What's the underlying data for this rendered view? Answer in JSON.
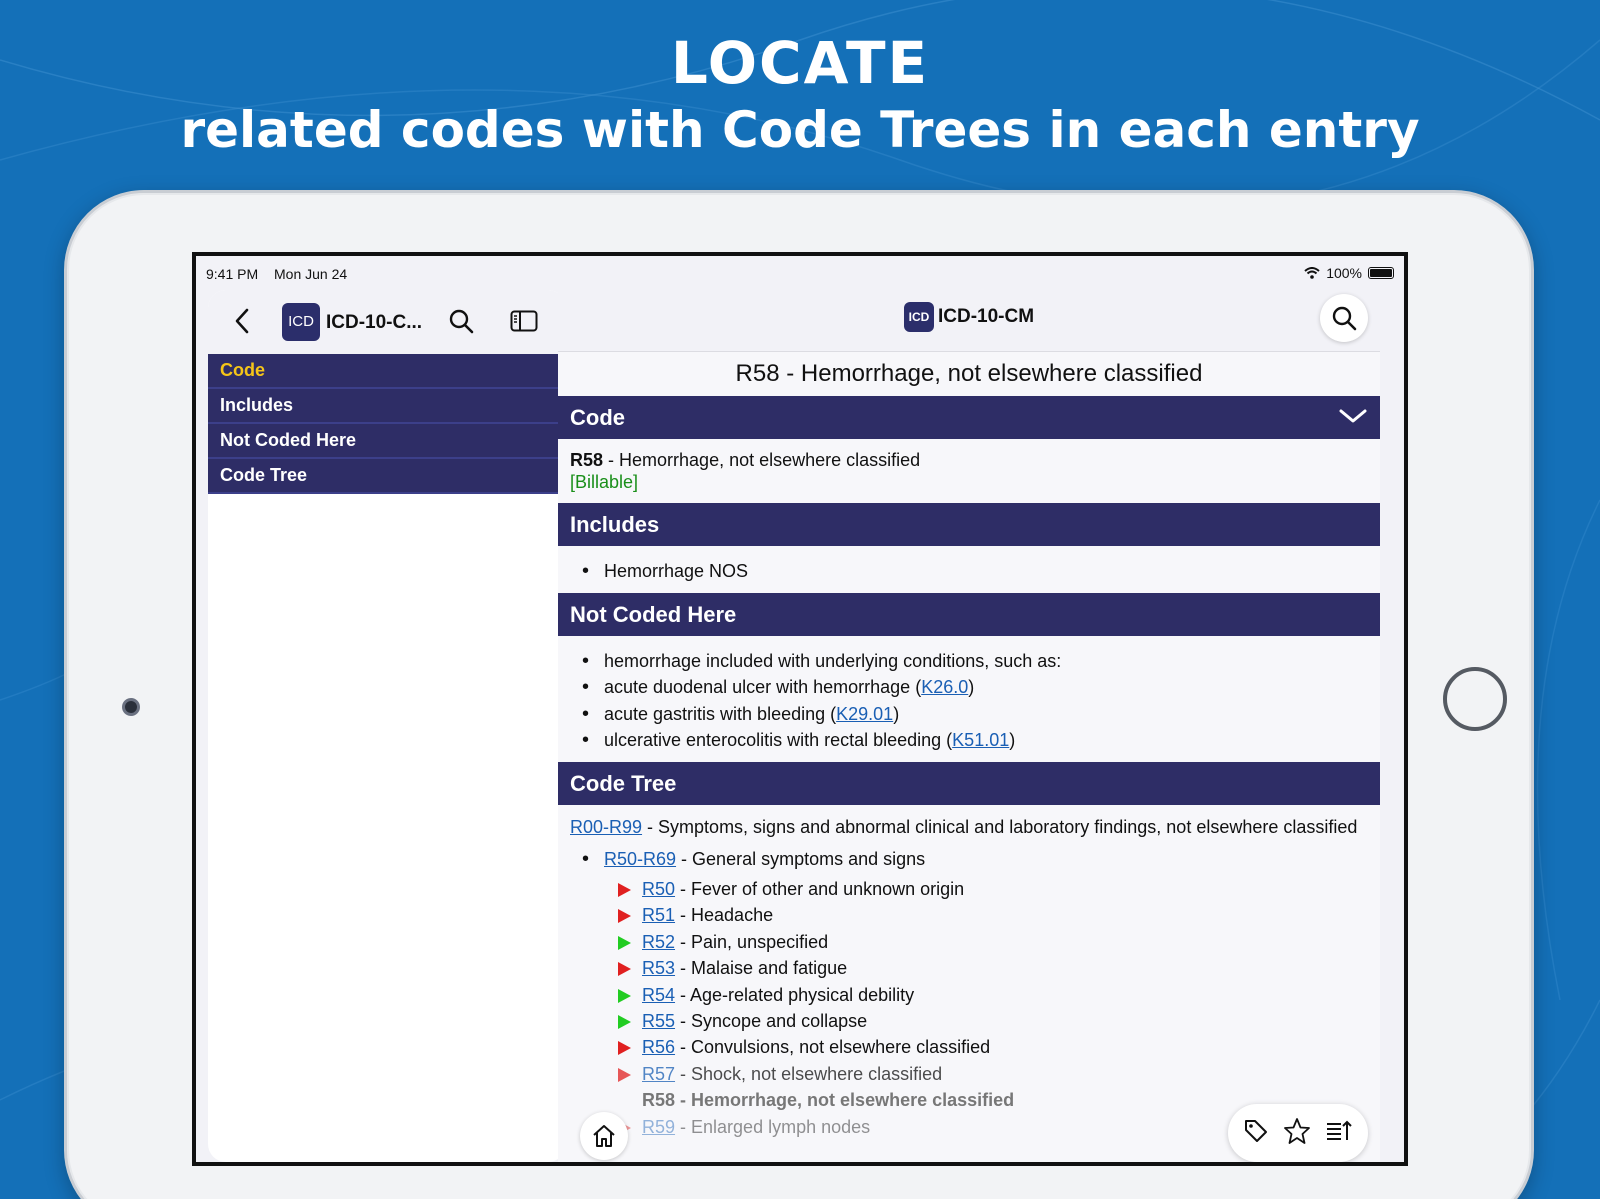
{
  "headline": {
    "line1": "LOCATE",
    "line2": "related codes with Code Trees in each entry"
  },
  "status_bar": {
    "time": "9:41 PM",
    "date": "Mon Jun 24",
    "battery": "100%"
  },
  "sidebar": {
    "app_icon_text": "ICD",
    "title": "ICD-10-C...",
    "nav_items": [
      {
        "label": "Code",
        "active": true
      },
      {
        "label": "Includes",
        "active": false
      },
      {
        "label": "Not Coded Here",
        "active": false
      },
      {
        "label": "Code Tree",
        "active": false
      }
    ]
  },
  "main": {
    "app_icon_text": "ICD",
    "app_title": "ICD-10-CM",
    "entry_title": "R58 - Hemorrhage, not elsewhere classified",
    "code_section": {
      "heading": "Code",
      "code": "R58",
      "description": " - Hemorrhage, not elsewhere classified",
      "billable": "[Billable]"
    },
    "includes_section": {
      "heading": "Includes",
      "items": [
        "Hemorrhage NOS"
      ]
    },
    "not_coded_section": {
      "heading": "Not Coded Here",
      "items": [
        {
          "text": "hemorrhage included with underlying conditions, such as:",
          "link": "",
          "after": ""
        },
        {
          "text": "acute duodenal ulcer with hemorrhage (",
          "link": "K26.0",
          "after": ")"
        },
        {
          "text": "acute gastritis with bleeding (",
          "link": "K29.01",
          "after": ")"
        },
        {
          "text": "ulcerative enterocolitis with rectal bleeding (",
          "link": "K51.01",
          "after": ")"
        }
      ]
    },
    "code_tree_section": {
      "heading": "Code Tree",
      "root_link": "R00-R99",
      "root_text": " - Symptoms, signs and abnormal clinical and laboratory findings, not elsewhere classified",
      "level1_link": "R50-R69",
      "level1_text": " - General symptoms and signs",
      "children": [
        {
          "code": "R50",
          "text": " - Fever of other and unknown origin",
          "marker": "red",
          "state": "normal"
        },
        {
          "code": "R51",
          "text": " - Headache",
          "marker": "red",
          "state": "normal"
        },
        {
          "code": "R52",
          "text": " - Pain, unspecified",
          "marker": "green",
          "state": "normal"
        },
        {
          "code": "R53",
          "text": " - Malaise and fatigue",
          "marker": "red",
          "state": "normal"
        },
        {
          "code": "R54",
          "text": " - Age-related physical debility",
          "marker": "green",
          "state": "normal"
        },
        {
          "code": "R55",
          "text": " - Syncope and collapse",
          "marker": "green",
          "state": "normal"
        },
        {
          "code": "R56",
          "text": " - Convulsions, not elsewhere classified",
          "marker": "red",
          "state": "normal"
        },
        {
          "code": "R57",
          "text": " - Shock, not elsewhere classified",
          "marker": "red",
          "state": "dim"
        },
        {
          "code": "R58",
          "text": " - Hemorrhage, not elsewhere classified",
          "marker": "none",
          "state": "current"
        },
        {
          "code": "R59",
          "text": " - Enlarged lymph nodes",
          "marker": "red",
          "state": "faded"
        }
      ]
    }
  },
  "colors": {
    "background": "#1470b8",
    "section_header": "#2e2d66",
    "active_nav": "#f5c518",
    "billable": "#1a8f1a",
    "link": "#1a5fb4",
    "marker_red": "#e02020",
    "marker_green": "#22cc22"
  },
  "icons": [
    "chevron-left-icon",
    "search-icon",
    "sidebar-toggle-icon",
    "chevron-down-icon",
    "home-icon",
    "tag-icon",
    "star-icon",
    "list-jump-icon",
    "wifi-icon",
    "battery-icon"
  ]
}
